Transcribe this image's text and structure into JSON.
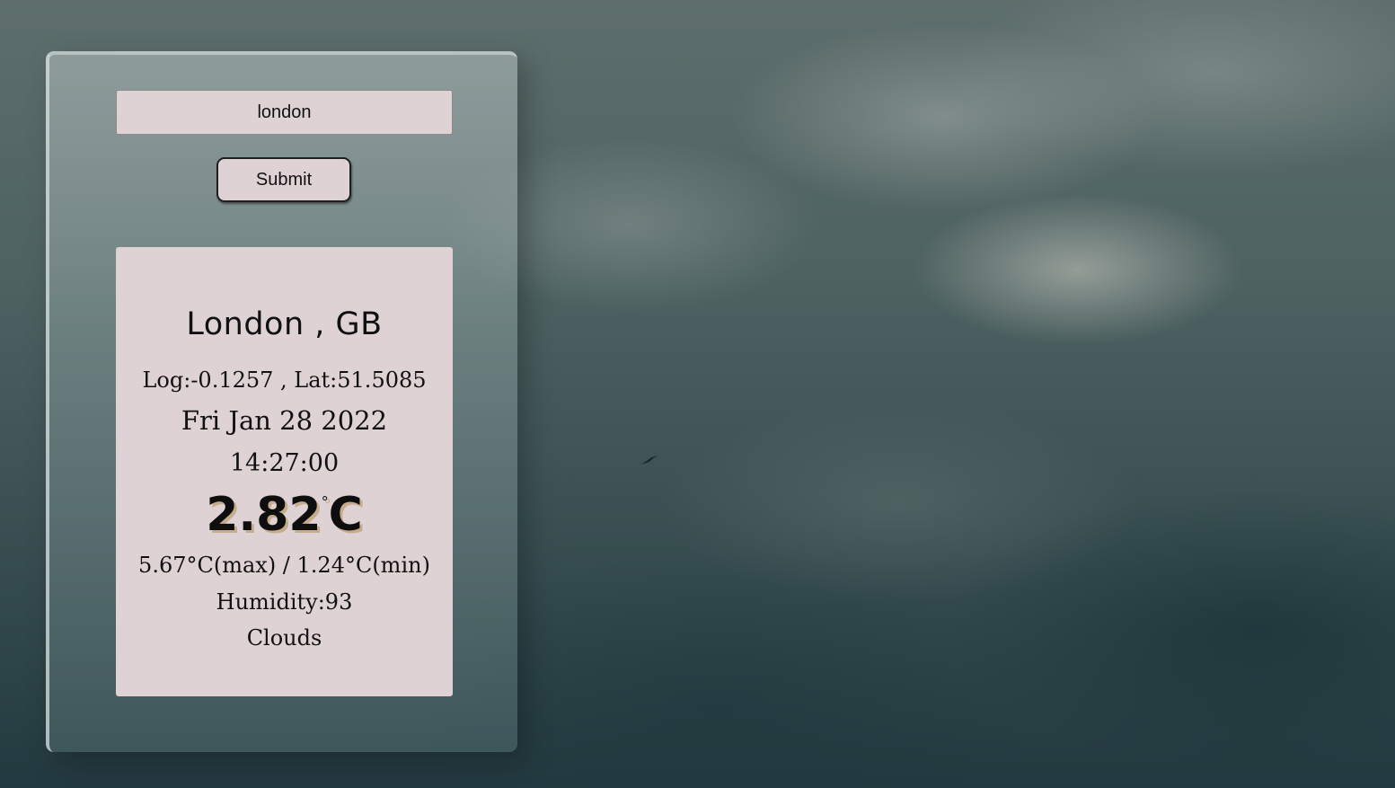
{
  "search": {
    "value": "london"
  },
  "submit": {
    "label": "Submit"
  },
  "weather": {
    "location": "London , GB",
    "coordinates": "Log:-0.1257 , Lat:51.5085",
    "date": "Fri Jan 28 2022",
    "time": "14:27:00",
    "temperature": "2.82",
    "degree_symbol": "°",
    "temperature_unit": "C",
    "range": "5.67°C(max) / 1.24°C(min)",
    "humidity": "Humidity:93",
    "condition": "Clouds"
  },
  "colors": {
    "panel_bg": "#ded2d4",
    "temperature_shadow": "#c5ac8a",
    "text": "#111111"
  },
  "icons": {
    "bird": "bird-silhouette-icon"
  }
}
